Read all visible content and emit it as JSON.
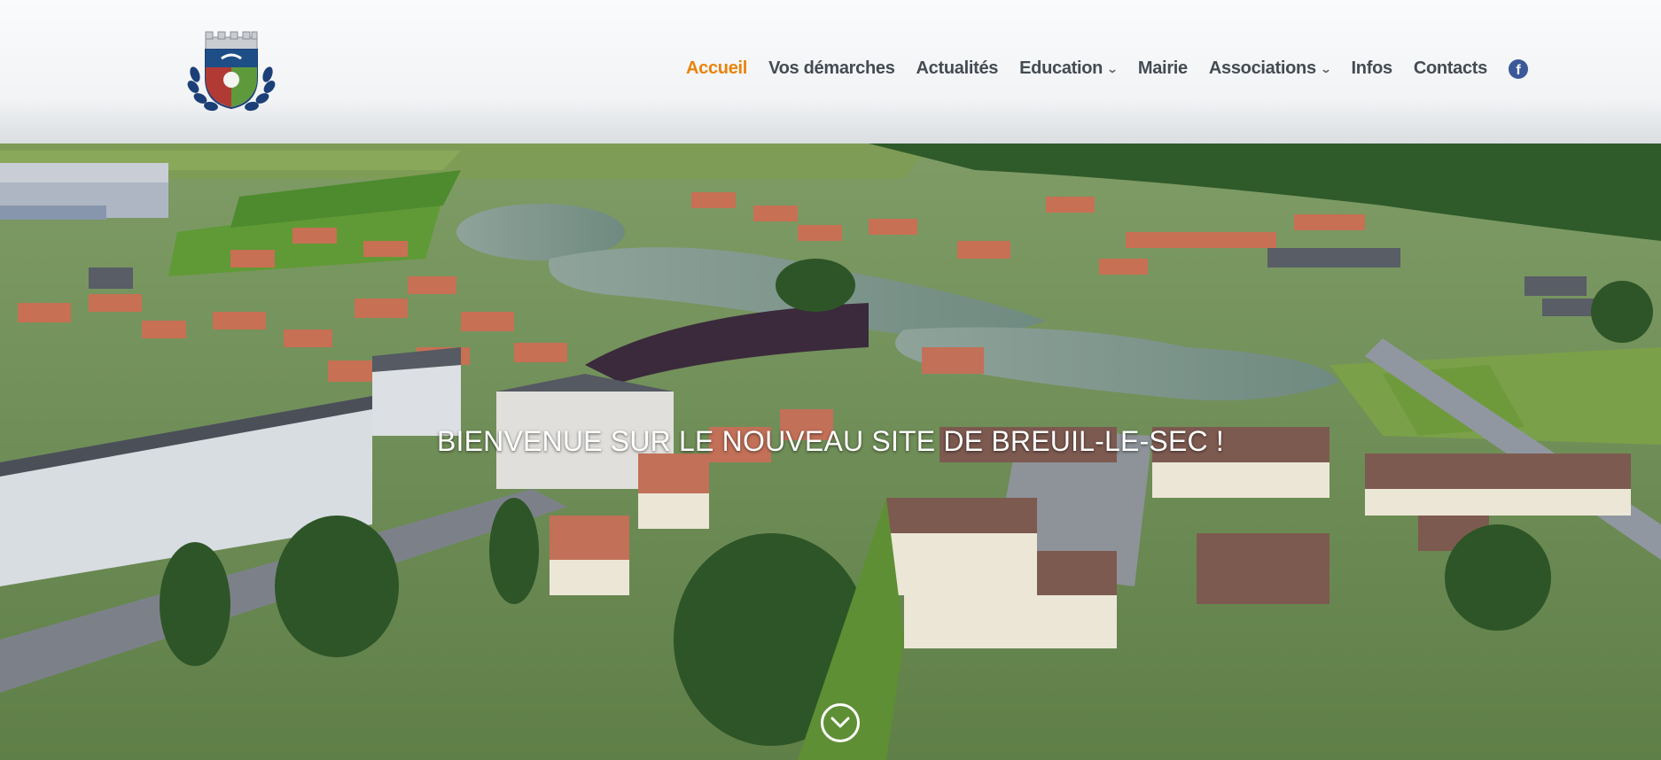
{
  "header": {
    "logo_icon": "town-coat-of-arms-icon",
    "nav": [
      {
        "label": "Accueil",
        "active": true,
        "has_dropdown": false
      },
      {
        "label": "Vos démarches",
        "active": false,
        "has_dropdown": false
      },
      {
        "label": "Actualités",
        "active": false,
        "has_dropdown": false
      },
      {
        "label": "Education",
        "active": false,
        "has_dropdown": true
      },
      {
        "label": "Mairie",
        "active": false,
        "has_dropdown": false
      },
      {
        "label": "Associations",
        "active": false,
        "has_dropdown": true
      },
      {
        "label": "Infos",
        "active": false,
        "has_dropdown": false
      },
      {
        "label": "Contacts",
        "active": false,
        "has_dropdown": false
      }
    ],
    "social_icon": "facebook-icon",
    "colors": {
      "accent": "#e8830b",
      "nav_text": "#444b52",
      "facebook": "#3b5998"
    }
  },
  "hero": {
    "title": "BIENVENUE SUR LE NOUVEAU SITE DE BREUIL-LE-SEC !",
    "background": "aerial-village-photo",
    "scroll_icon": "chevron-down-circle-icon"
  }
}
